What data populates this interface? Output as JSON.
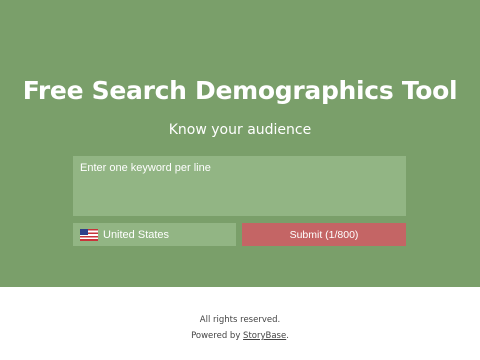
{
  "hero": {
    "title_prefix": "Free",
    "title_bold": "Search Demographics",
    "title_suffix": "Tool",
    "subtitle": "Know your audience",
    "keyword_placeholder": "Enter one keyword per line",
    "country": {
      "label": "United States",
      "flag_icon": "us-flag-icon"
    },
    "submit_label": "Submit (1/800)"
  },
  "footer": {
    "rights": "All rights reserved.",
    "powered_by": "Powered by",
    "brand_link": "StoryBase",
    "period": "."
  },
  "colors": {
    "hero_background": "#7a9f6a",
    "input_background": "#92b584",
    "submit_background": "#c46565"
  }
}
